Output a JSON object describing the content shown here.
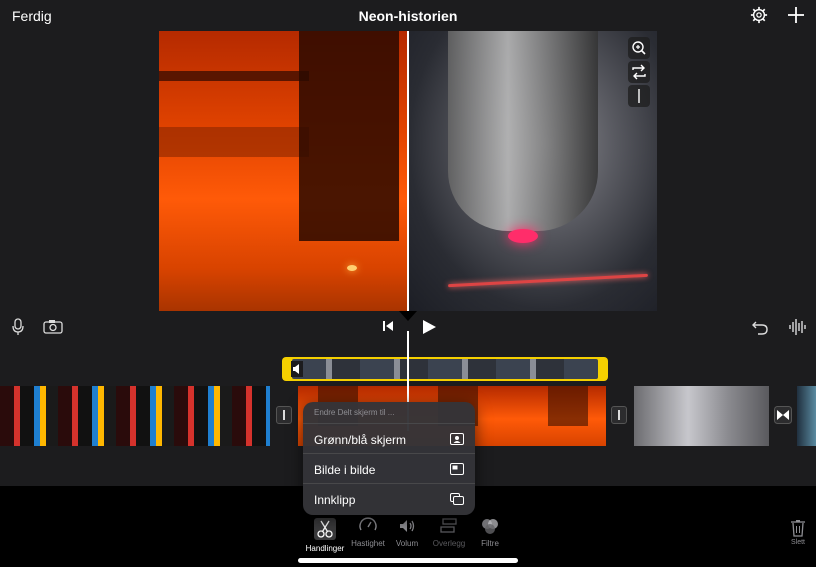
{
  "topbar": {
    "done_label": "Ferdig",
    "project_title": "Neon-historien",
    "settings_icon": "gear-icon",
    "add_icon": "plus-icon"
  },
  "viewer": {
    "buttons": [
      "zoom-icon",
      "swap-icon",
      "divider-line-icon"
    ]
  },
  "timeline": {
    "controls": [
      "microphone-icon",
      "camera-icon",
      "skip-to-start-icon",
      "play-icon",
      "undo-icon",
      "audio-waveform-icon"
    ]
  },
  "popover": {
    "header": "Endre Delt skjerm til ...",
    "items": [
      {
        "label": "Grønn/blå skjerm",
        "icon": "person-screen-icon"
      },
      {
        "label": "Bilde i bilde",
        "icon": "picture-in-picture-icon"
      },
      {
        "label": "Innklipp",
        "icon": "cutaway-icon"
      }
    ]
  },
  "toolbar": {
    "tools": [
      {
        "label": "Handlinger",
        "icon": "scissors-icon",
        "active": true
      },
      {
        "label": "Hastighet",
        "icon": "speedometer-icon"
      },
      {
        "label": "Volum",
        "icon": "speaker-icon"
      },
      {
        "label": "Overlegg",
        "icon": "overlay-icon"
      },
      {
        "label": "Filtre",
        "icon": "filter-circles-icon"
      }
    ],
    "delete_label": "Slett"
  }
}
